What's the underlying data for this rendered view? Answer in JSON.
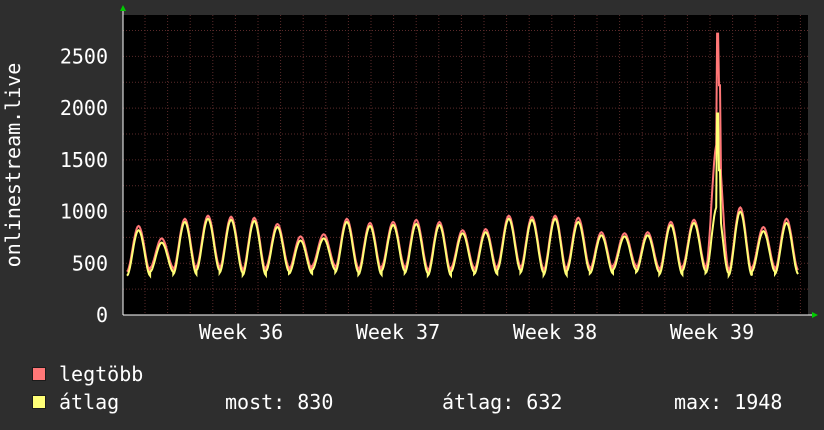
{
  "chart_data": {
    "type": "line",
    "ylabel": "onlinestream.live",
    "xlabel": "",
    "title": "",
    "ylim": [
      0,
      2900
    ],
    "yticks": [
      "0",
      "500",
      "1000",
      "1500",
      "2000",
      "2500"
    ],
    "ytick_values": [
      0,
      500,
      1000,
      1500,
      2000,
      2500
    ],
    "xticks": [
      "Week 36",
      "Week 37",
      "Week 38",
      "Week 39"
    ],
    "grid": true,
    "colors": {
      "background": "#2e2e2e",
      "plot_background": "#000000",
      "grid": "#5a2a2a",
      "axis": "#ffffff",
      "arrow": "#00cc00",
      "max_series": "#ff7777",
      "avg_series": "#ffff77"
    },
    "series": [
      {
        "name": "legtöbb",
        "color": "#ff7777",
        "daily_peaks": [
          860,
          740,
          930,
          960,
          950,
          940,
          880,
          760,
          780,
          930,
          890,
          900,
          920,
          900,
          820,
          830,
          960,
          950,
          960,
          940,
          800,
          790,
          800,
          900,
          920,
          2700,
          1040,
          850,
          930
        ],
        "spike_values": [
          2720,
          2220
        ]
      },
      {
        "name": "átlag",
        "color": "#ffff77",
        "daily_peaks": [
          820,
          700,
          900,
          930,
          920,
          910,
          850,
          720,
          740,
          900,
          860,
          870,
          880,
          870,
          790,
          800,
          930,
          920,
          930,
          900,
          770,
          760,
          770,
          870,
          890,
          1940,
          1000,
          810,
          890
        ],
        "spike_values": [
          1948,
          1400
        ]
      }
    ]
  },
  "legend": {
    "items": [
      {
        "label": "legtöbb",
        "color": "#ff7777"
      },
      {
        "label": "átlag",
        "color": "#ffff77"
      }
    ],
    "stats": {
      "now": "most: 830",
      "avg": "átlag: 632",
      "max": "max: 1948"
    }
  }
}
